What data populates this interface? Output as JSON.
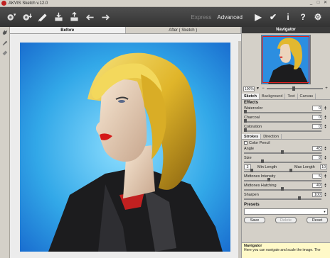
{
  "window": {
    "title": "AKVIS Sketch v.12.0",
    "controls": [
      "_",
      "□",
      "✕"
    ]
  },
  "toolbar": {
    "tools": [
      {
        "icon": "open-image-icon"
      },
      {
        "icon": "save-image-icon"
      },
      {
        "icon": "run-brush-icon"
      },
      {
        "icon": "batch-in-icon"
      },
      {
        "icon": "batch-out-icon"
      },
      {
        "icon": "undo-arrow-icon"
      },
      {
        "icon": "redo-arrow-icon"
      }
    ],
    "mode_express": "Express",
    "mode_advanced": "Advanced",
    "run_glyph": "▶",
    "apply_glyph": "✔",
    "info_glyph": "i",
    "help_glyph": "?",
    "settings_glyph": "⚙"
  },
  "canvas": {
    "tab_before": "Before",
    "tab_after": "After ( Sketch )"
  },
  "navigator": {
    "title": "Navigator",
    "zoom": "100%",
    "zoom_minus": "−",
    "zoom_plus": "+"
  },
  "settings_tabs": [
    "Sketch",
    "Background",
    "Text",
    "Canvas"
  ],
  "effects": {
    "title": "Effects",
    "params": [
      {
        "label": "Watercolor",
        "value": "0"
      },
      {
        "label": "Charcoal",
        "value": "0"
      },
      {
        "label": "Coloration",
        "value": "0"
      }
    ]
  },
  "strokes": {
    "color_pencil_label": "Color Pencil",
    "subtabs": [
      "Strokes",
      "Direction"
    ],
    "angle": {
      "label": "Angle",
      "value": "45"
    },
    "size": {
      "label": "Size",
      "value": "8"
    },
    "length": {
      "min_label": "Min Length",
      "max_label": "Max Length",
      "min_value": "3",
      "max_value": "10"
    },
    "params": [
      {
        "label": "Midtones Intensity",
        "value": "5"
      },
      {
        "label": "Midtones Hatching",
        "value": "49"
      },
      {
        "label": "Sharpen",
        "value": "100"
      }
    ]
  },
  "presets": {
    "title": "Presets",
    "save": "Save",
    "delete": "Delete",
    "reset": "Reset"
  },
  "hint": {
    "title": "Navigator",
    "text": "Here you can navigate and scale the image. The"
  },
  "colors": {
    "toolbar": "#3c3c3c",
    "accent": "#2a6bd8",
    "hint_bg": "#fff9c8"
  }
}
